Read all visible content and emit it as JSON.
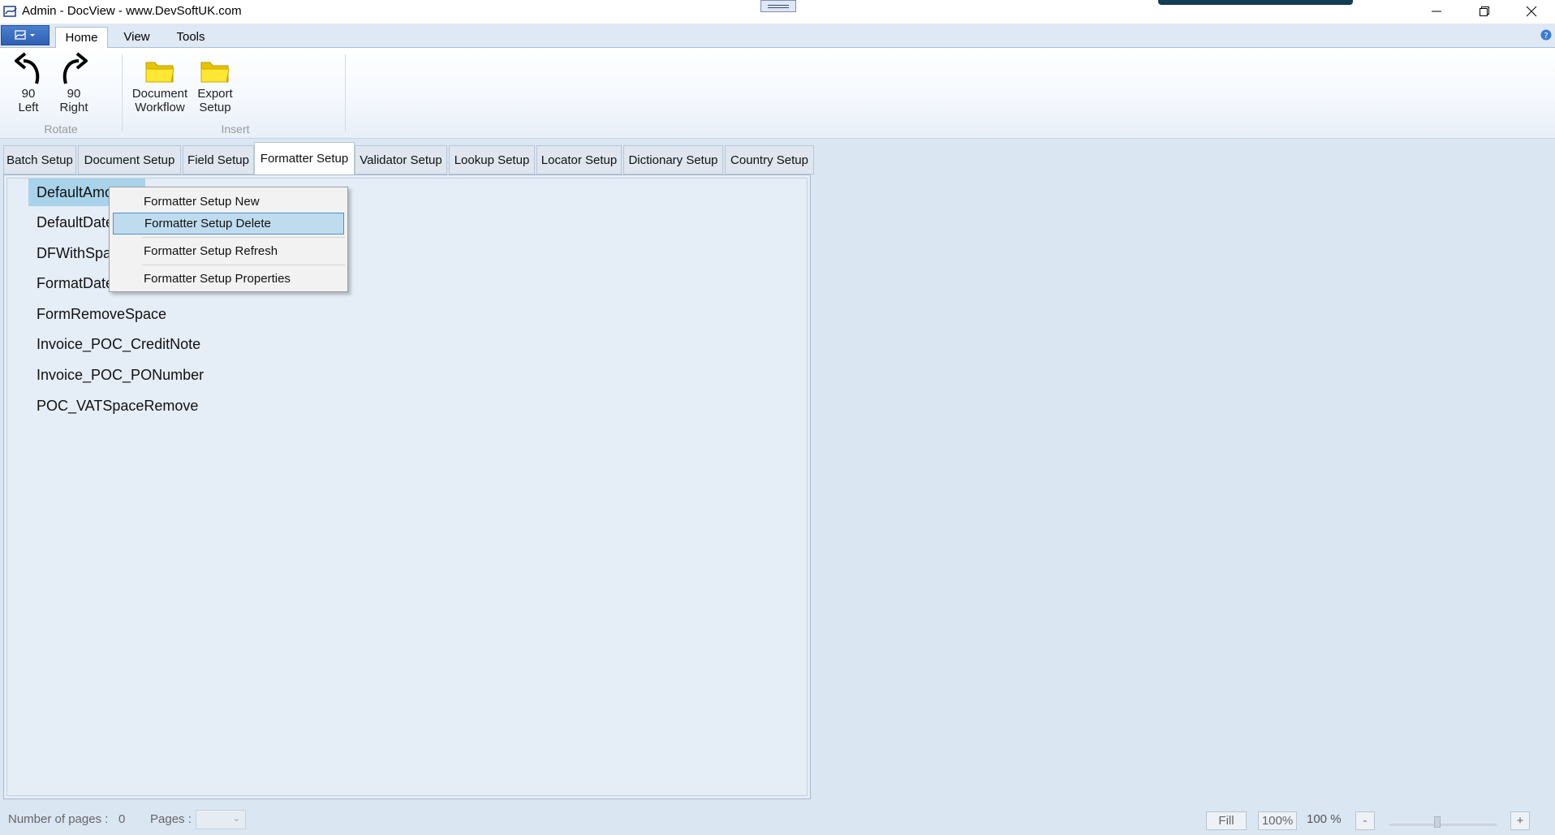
{
  "window": {
    "title": "Admin - DocView - www.DevSoftUK.com"
  },
  "ribbon": {
    "tabs": [
      {
        "label": "Home",
        "active": true
      },
      {
        "label": "View",
        "active": false
      },
      {
        "label": "Tools",
        "active": false
      }
    ],
    "groups": {
      "rotate": {
        "label": "Rotate",
        "buttons": [
          {
            "line1": "90",
            "line2": "Left",
            "icon": "rotate-left-icon"
          },
          {
            "line1": "90",
            "line2": "Right",
            "icon": "rotate-right-icon"
          }
        ]
      },
      "insert": {
        "label": "Insert",
        "buttons": [
          {
            "line1": "Document",
            "line2": "Workflow",
            "icon": "folder-icon"
          },
          {
            "line1": "Export",
            "line2": "Setup",
            "icon": "folder-icon"
          }
        ]
      }
    }
  },
  "setup_tabs": [
    {
      "label": "Batch Setup"
    },
    {
      "label": "Document Setup"
    },
    {
      "label": "Field Setup"
    },
    {
      "label": "Formatter Setup",
      "active": true
    },
    {
      "label": "Validator Setup"
    },
    {
      "label": "Lookup Setup"
    },
    {
      "label": "Locator Setup"
    },
    {
      "label": "Dictionary Setup"
    },
    {
      "label": "Country Setup"
    }
  ],
  "formatter_list": [
    {
      "label": "DefaultAmount",
      "selected": true
    },
    {
      "label": "DefaultDate"
    },
    {
      "label": "DFWithSpace"
    },
    {
      "label": "FormatDate"
    },
    {
      "label": "FormRemoveSpace"
    },
    {
      "label": "Invoice_POC_CreditNote"
    },
    {
      "label": "Invoice_POC_PONumber"
    },
    {
      "label": "POC_VATSpaceRemove"
    }
  ],
  "context_menu": {
    "items": [
      {
        "label": "Formatter Setup New"
      },
      {
        "label": "Formatter Setup Delete",
        "highlighted": true
      },
      {
        "label": "Formatter Setup Refresh"
      },
      {
        "label": "Formatter Setup Properties"
      }
    ]
  },
  "statusbar": {
    "num_pages_label": "Number of pages :",
    "num_pages_value": "0",
    "pages_label": "Pages :",
    "fill_label": "Fill",
    "hundred_label": "100%",
    "zoom_value": "100 %",
    "minus_label": "-",
    "plus_label": "+"
  },
  "colors": {
    "selection": "#a8d3ea",
    "menu_highlight": "#bfdcee",
    "main_background": "#dbe6f3"
  }
}
